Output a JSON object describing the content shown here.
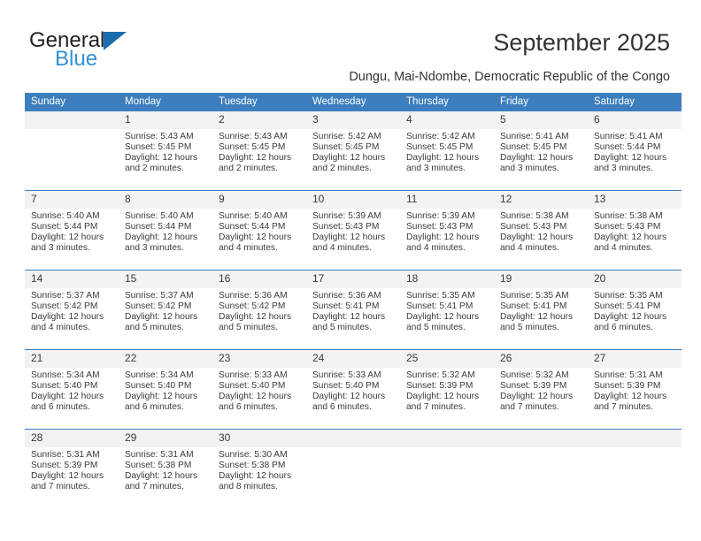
{
  "brand": {
    "name_part1": "General",
    "name_part2": "Blue",
    "logo_icon": "triangle-icon",
    "colors": {
      "triangle": "#1b6cb0",
      "blue_text": "#2e92d8",
      "general_text": "#231f20"
    }
  },
  "header": {
    "title": "September 2025",
    "subtitle": "Dungu, Mai-Ndombe, Democratic Republic of the Congo"
  },
  "calendar": {
    "accent_color": "#3c7ebe",
    "daynum_bg": "#f2f2f2",
    "weekday_headers": [
      "Sunday",
      "Monday",
      "Tuesday",
      "Wednesday",
      "Thursday",
      "Friday",
      "Saturday"
    ],
    "weeks": [
      [
        {
          "day": "",
          "lines": []
        },
        {
          "day": "1",
          "lines": [
            "Sunrise: 5:43 AM",
            "Sunset: 5:45 PM",
            "Daylight: 12 hours",
            "and 2 minutes."
          ]
        },
        {
          "day": "2",
          "lines": [
            "Sunrise: 5:43 AM",
            "Sunset: 5:45 PM",
            "Daylight: 12 hours",
            "and 2 minutes."
          ]
        },
        {
          "day": "3",
          "lines": [
            "Sunrise: 5:42 AM",
            "Sunset: 5:45 PM",
            "Daylight: 12 hours",
            "and 2 minutes."
          ]
        },
        {
          "day": "4",
          "lines": [
            "Sunrise: 5:42 AM",
            "Sunset: 5:45 PM",
            "Daylight: 12 hours",
            "and 3 minutes."
          ]
        },
        {
          "day": "5",
          "lines": [
            "Sunrise: 5:41 AM",
            "Sunset: 5:45 PM",
            "Daylight: 12 hours",
            "and 3 minutes."
          ]
        },
        {
          "day": "6",
          "lines": [
            "Sunrise: 5:41 AM",
            "Sunset: 5:44 PM",
            "Daylight: 12 hours",
            "and 3 minutes."
          ]
        }
      ],
      [
        {
          "day": "7",
          "lines": [
            "Sunrise: 5:40 AM",
            "Sunset: 5:44 PM",
            "Daylight: 12 hours",
            "and 3 minutes."
          ]
        },
        {
          "day": "8",
          "lines": [
            "Sunrise: 5:40 AM",
            "Sunset: 5:44 PM",
            "Daylight: 12 hours",
            "and 3 minutes."
          ]
        },
        {
          "day": "9",
          "lines": [
            "Sunrise: 5:40 AM",
            "Sunset: 5:44 PM",
            "Daylight: 12 hours",
            "and 4 minutes."
          ]
        },
        {
          "day": "10",
          "lines": [
            "Sunrise: 5:39 AM",
            "Sunset: 5:43 PM",
            "Daylight: 12 hours",
            "and 4 minutes."
          ]
        },
        {
          "day": "11",
          "lines": [
            "Sunrise: 5:39 AM",
            "Sunset: 5:43 PM",
            "Daylight: 12 hours",
            "and 4 minutes."
          ]
        },
        {
          "day": "12",
          "lines": [
            "Sunrise: 5:38 AM",
            "Sunset: 5:43 PM",
            "Daylight: 12 hours",
            "and 4 minutes."
          ]
        },
        {
          "day": "13",
          "lines": [
            "Sunrise: 5:38 AM",
            "Sunset: 5:43 PM",
            "Daylight: 12 hours",
            "and 4 minutes."
          ]
        }
      ],
      [
        {
          "day": "14",
          "lines": [
            "Sunrise: 5:37 AM",
            "Sunset: 5:42 PM",
            "Daylight: 12 hours",
            "and 4 minutes."
          ]
        },
        {
          "day": "15",
          "lines": [
            "Sunrise: 5:37 AM",
            "Sunset: 5:42 PM",
            "Daylight: 12 hours",
            "and 5 minutes."
          ]
        },
        {
          "day": "16",
          "lines": [
            "Sunrise: 5:36 AM",
            "Sunset: 5:42 PM",
            "Daylight: 12 hours",
            "and 5 minutes."
          ]
        },
        {
          "day": "17",
          "lines": [
            "Sunrise: 5:36 AM",
            "Sunset: 5:41 PM",
            "Daylight: 12 hours",
            "and 5 minutes."
          ]
        },
        {
          "day": "18",
          "lines": [
            "Sunrise: 5:35 AM",
            "Sunset: 5:41 PM",
            "Daylight: 12 hours",
            "and 5 minutes."
          ]
        },
        {
          "day": "19",
          "lines": [
            "Sunrise: 5:35 AM",
            "Sunset: 5:41 PM",
            "Daylight: 12 hours",
            "and 5 minutes."
          ]
        },
        {
          "day": "20",
          "lines": [
            "Sunrise: 5:35 AM",
            "Sunset: 5:41 PM",
            "Daylight: 12 hours",
            "and 6 minutes."
          ]
        }
      ],
      [
        {
          "day": "21",
          "lines": [
            "Sunrise: 5:34 AM",
            "Sunset: 5:40 PM",
            "Daylight: 12 hours",
            "and 6 minutes."
          ]
        },
        {
          "day": "22",
          "lines": [
            "Sunrise: 5:34 AM",
            "Sunset: 5:40 PM",
            "Daylight: 12 hours",
            "and 6 minutes."
          ]
        },
        {
          "day": "23",
          "lines": [
            "Sunrise: 5:33 AM",
            "Sunset: 5:40 PM",
            "Daylight: 12 hours",
            "and 6 minutes."
          ]
        },
        {
          "day": "24",
          "lines": [
            "Sunrise: 5:33 AM",
            "Sunset: 5:40 PM",
            "Daylight: 12 hours",
            "and 6 minutes."
          ]
        },
        {
          "day": "25",
          "lines": [
            "Sunrise: 5:32 AM",
            "Sunset: 5:39 PM",
            "Daylight: 12 hours",
            "and 7 minutes."
          ]
        },
        {
          "day": "26",
          "lines": [
            "Sunrise: 5:32 AM",
            "Sunset: 5:39 PM",
            "Daylight: 12 hours",
            "and 7 minutes."
          ]
        },
        {
          "day": "27",
          "lines": [
            "Sunrise: 5:31 AM",
            "Sunset: 5:39 PM",
            "Daylight: 12 hours",
            "and 7 minutes."
          ]
        }
      ],
      [
        {
          "day": "28",
          "lines": [
            "Sunrise: 5:31 AM",
            "Sunset: 5:39 PM",
            "Daylight: 12 hours",
            "and 7 minutes."
          ]
        },
        {
          "day": "29",
          "lines": [
            "Sunrise: 5:31 AM",
            "Sunset: 5:38 PM",
            "Daylight: 12 hours",
            "and 7 minutes."
          ]
        },
        {
          "day": "30",
          "lines": [
            "Sunrise: 5:30 AM",
            "Sunset: 5:38 PM",
            "Daylight: 12 hours",
            "and 8 minutes."
          ]
        },
        {
          "day": "",
          "lines": []
        },
        {
          "day": "",
          "lines": []
        },
        {
          "day": "",
          "lines": []
        },
        {
          "day": "",
          "lines": []
        }
      ]
    ]
  }
}
